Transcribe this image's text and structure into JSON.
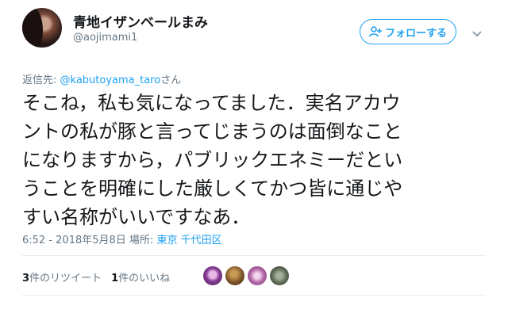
{
  "user": {
    "display_name": "青地イザンベールまみ",
    "screen_name": "@aojimami1"
  },
  "follow_button": {
    "label": "フォローする"
  },
  "reply": {
    "prefix": "返信先: ",
    "handle": "@kabutoyama_taro",
    "suffix": "さん"
  },
  "tweet": {
    "lines": [
      "そこね，私も気になってました．実名アカウ",
      "ントの私が豚と言ってじまうのは面倒なこと",
      "になりますから，パブリックエネミーだとい",
      "うことを明確にした厳しくてかつ皆に通じや",
      "すい名称がいいですなあ．"
    ]
  },
  "meta": {
    "time": "6:52 - 2018年5月8日",
    "place_label": "場所: ",
    "place": "東京 千代田区"
  },
  "stats": {
    "retweet_count": "3",
    "retweet_label": "件のリツイート",
    "like_count": "1",
    "like_label": "件のいいね"
  },
  "colors": {
    "accent": "#1da1f2",
    "secondary_text": "#657786",
    "divider": "#e6ecf0"
  },
  "icons": {
    "follow": "person-plus-icon",
    "menu": "chevron-down-icon"
  }
}
